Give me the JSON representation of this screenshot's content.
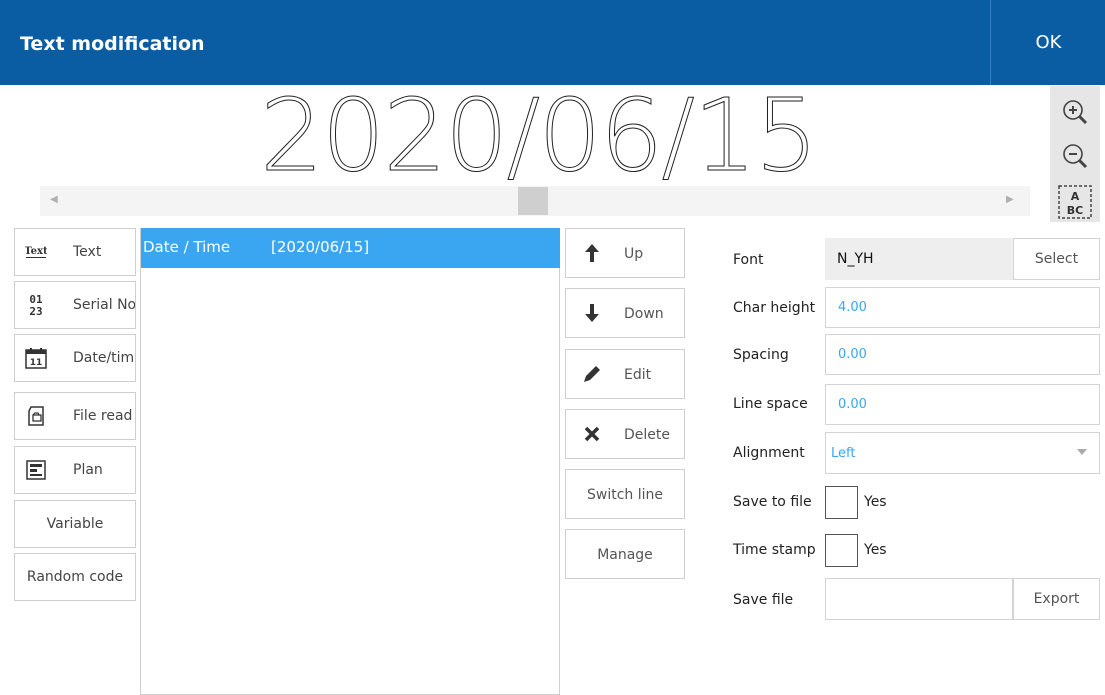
{
  "header": {
    "title": "Text modification",
    "ok_label": "OK"
  },
  "preview": {
    "text": "2020/06/15"
  },
  "left_buttons": [
    {
      "label": "Text",
      "icon": "text-icon"
    },
    {
      "label": "Serial No.",
      "icon": "serial-number-icon"
    },
    {
      "label": "Date/time",
      "icon": "calendar-icon"
    },
    {
      "label": "File read",
      "icon": "file-icon"
    },
    {
      "label": "Plan",
      "icon": "plan-icon"
    },
    {
      "label": "Variable"
    },
    {
      "label": "Random code"
    }
  ],
  "list": {
    "items": [
      {
        "type": "Date / Time",
        "value": "[2020/06/15]",
        "selected": true
      }
    ]
  },
  "mid_buttons": [
    {
      "label": "Up",
      "icon": "arrow-up-icon"
    },
    {
      "label": "Down",
      "icon": "arrow-down-icon"
    },
    {
      "label": "Edit",
      "icon": "pencil-icon"
    },
    {
      "label": "Delete",
      "icon": "delete-x-icon"
    },
    {
      "label": "Switch line"
    },
    {
      "label": "Manage"
    }
  ],
  "form": {
    "font_label": "Font",
    "font_value": "N_YH",
    "select_label": "Select",
    "char_height_label": "Char height",
    "char_height_value": "4.00",
    "spacing_label": "Spacing",
    "spacing_value": "0.00",
    "line_space_label": "Line space",
    "line_space_value": "0.00",
    "alignment_label": "Alignment",
    "alignment_value": "Left",
    "save_to_file_label": "Save to file",
    "save_to_file_option": "Yes",
    "time_stamp_label": "Time stamp",
    "time_stamp_option": "Yes",
    "save_file_label": "Save file",
    "save_file_value": "",
    "export_label": "Export"
  },
  "colors": {
    "header": "#0a5da3",
    "selection": "#3aa6f1",
    "value_text": "#3aa6f1"
  }
}
